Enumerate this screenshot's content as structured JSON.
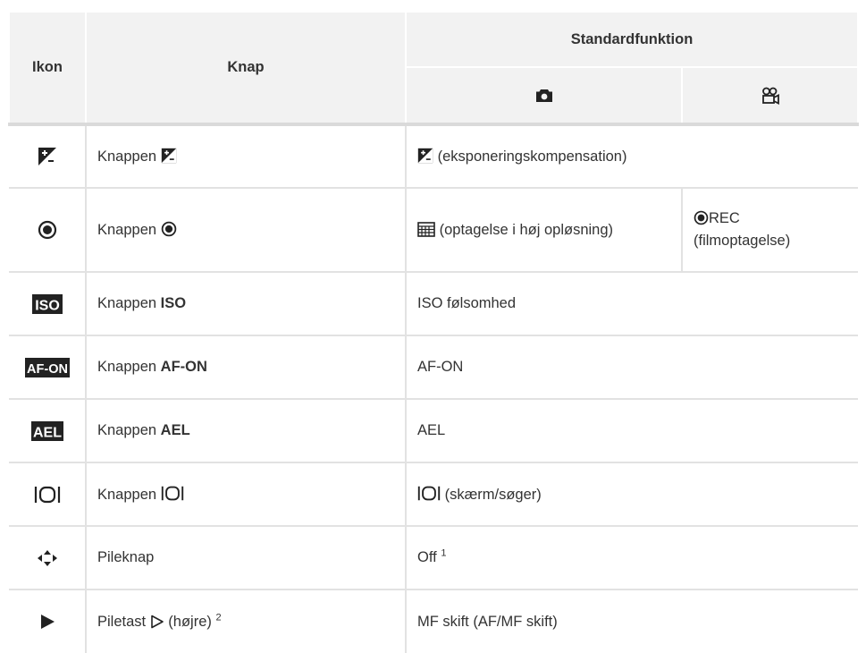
{
  "header": {
    "icon_col": "Ikon",
    "button_col": "Knap",
    "default_function": "Standardfunktion",
    "photo_icon": "camera-icon",
    "movie_icon": "movie-camera-icon"
  },
  "rows": [
    {
      "icon": "exposure-compensation-icon",
      "button_prefix": "Knappen",
      "function": "(eksponeringskompensation)"
    },
    {
      "icon": "record-icon",
      "button_prefix": "Knappen",
      "function_photo": "(optagelse i høj opløsning)",
      "function_movie_1": "REC",
      "function_movie_2": "(filmoptagelse)"
    },
    {
      "icon": "iso-icon",
      "button_prefix": "Knappen",
      "button_bold": "ISO",
      "function": "ISO følsomhed"
    },
    {
      "icon": "af-on-icon",
      "button_prefix": "Knappen",
      "button_bold": "AF-ON",
      "function": "AF-ON"
    },
    {
      "icon": "ael-icon",
      "button_prefix": "Knappen",
      "button_bold": "AEL",
      "function": "AEL"
    },
    {
      "icon": "lv-switch-icon",
      "button_prefix": "Knappen",
      "function": "(skærm/søger)"
    },
    {
      "icon": "arrow-pad-icon",
      "button": "Pileknap",
      "function": "Off",
      "function_note": "1"
    },
    {
      "icon": "right-arrow-icon",
      "button_prefix": "Piletast",
      "button_suffix": "(højre)",
      "button_note": "2",
      "function": "MF skift (AF/MF skift)"
    }
  ],
  "badges": {
    "iso": "ISO",
    "af_on": "AF-ON",
    "ael": "AEL"
  }
}
